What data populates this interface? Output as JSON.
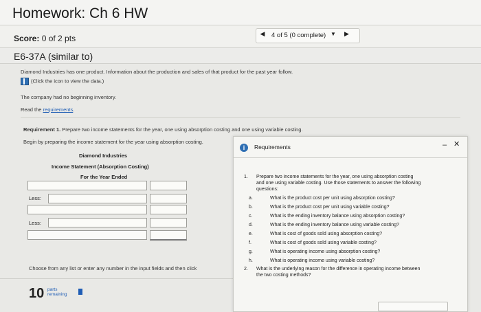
{
  "window": {
    "title": "Homework: Ch 6 HW"
  },
  "score": {
    "label": "Score:",
    "value": "0 of 2 pts"
  },
  "nav": {
    "status": "4 of 5 (0 complete)"
  },
  "question": {
    "title": "E6-37A (similar to)",
    "intro1": "Diamond Industries has one product. Information about the production and sales of that product for the past year follow.",
    "intro2": "(Click the icon to view the data.)",
    "intro3": "The company had no beginning inventory.",
    "read_prefix": "Read the ",
    "read_link": "requirements",
    "read_suffix": ".",
    "req_label": "Requirement 1.",
    "req_text": " Prepare two income statements for the year, one using absorption costing and one using variable costing.",
    "begin_text": "Begin by preparing the income statement for the year using absorption costing."
  },
  "statement": {
    "company": "Diamond Industries",
    "title": "Income Statement (Absorption Costing)",
    "period": "For the Year Ended",
    "less1": "Less:",
    "less2": "Less:"
  },
  "footer": {
    "hint": "Choose from any list or enter any number in the input fields and then click",
    "parts_count": "10",
    "parts_line1": "parts",
    "parts_line2": "remaining"
  },
  "popup": {
    "title": "Requirements",
    "item1_num": "1.",
    "item1_l1": "Prepare two income statements for the year, one using absorption costing",
    "item1_l2": "and one using variable costing. Use those statements to answer the following",
    "item1_l3": "questions:",
    "subs": [
      {
        "letter": "a.",
        "text": "What is the product cost per unit using absorption costing?"
      },
      {
        "letter": "b.",
        "text": "What is the product cost per unit using variable costing?"
      },
      {
        "letter": "c.",
        "text": "What is the ending inventory balance using absorption costing?"
      },
      {
        "letter": "d.",
        "text": "What is the ending inventory balance using variable costing?"
      },
      {
        "letter": "e.",
        "text": "What is cost of goods sold using absorption costing?"
      },
      {
        "letter": "f.",
        "text": "What is cost of goods sold using variable costing?"
      },
      {
        "letter": "g.",
        "text": "What is operating income using absorption costing?"
      },
      {
        "letter": "h.",
        "text": "What is operating income using variable costing?"
      }
    ],
    "item2_num": "2.",
    "item2_l1": "What is the underlying reason for the difference in operating income between",
    "item2_l2": "the two costing methods?"
  },
  "icons": {
    "info": "info-icon",
    "data": "table-icon",
    "close": "close-icon",
    "minimize": "minimize-icon"
  },
  "colors": {
    "accent": "#2f6fb3",
    "link": "#1f5db5"
  }
}
